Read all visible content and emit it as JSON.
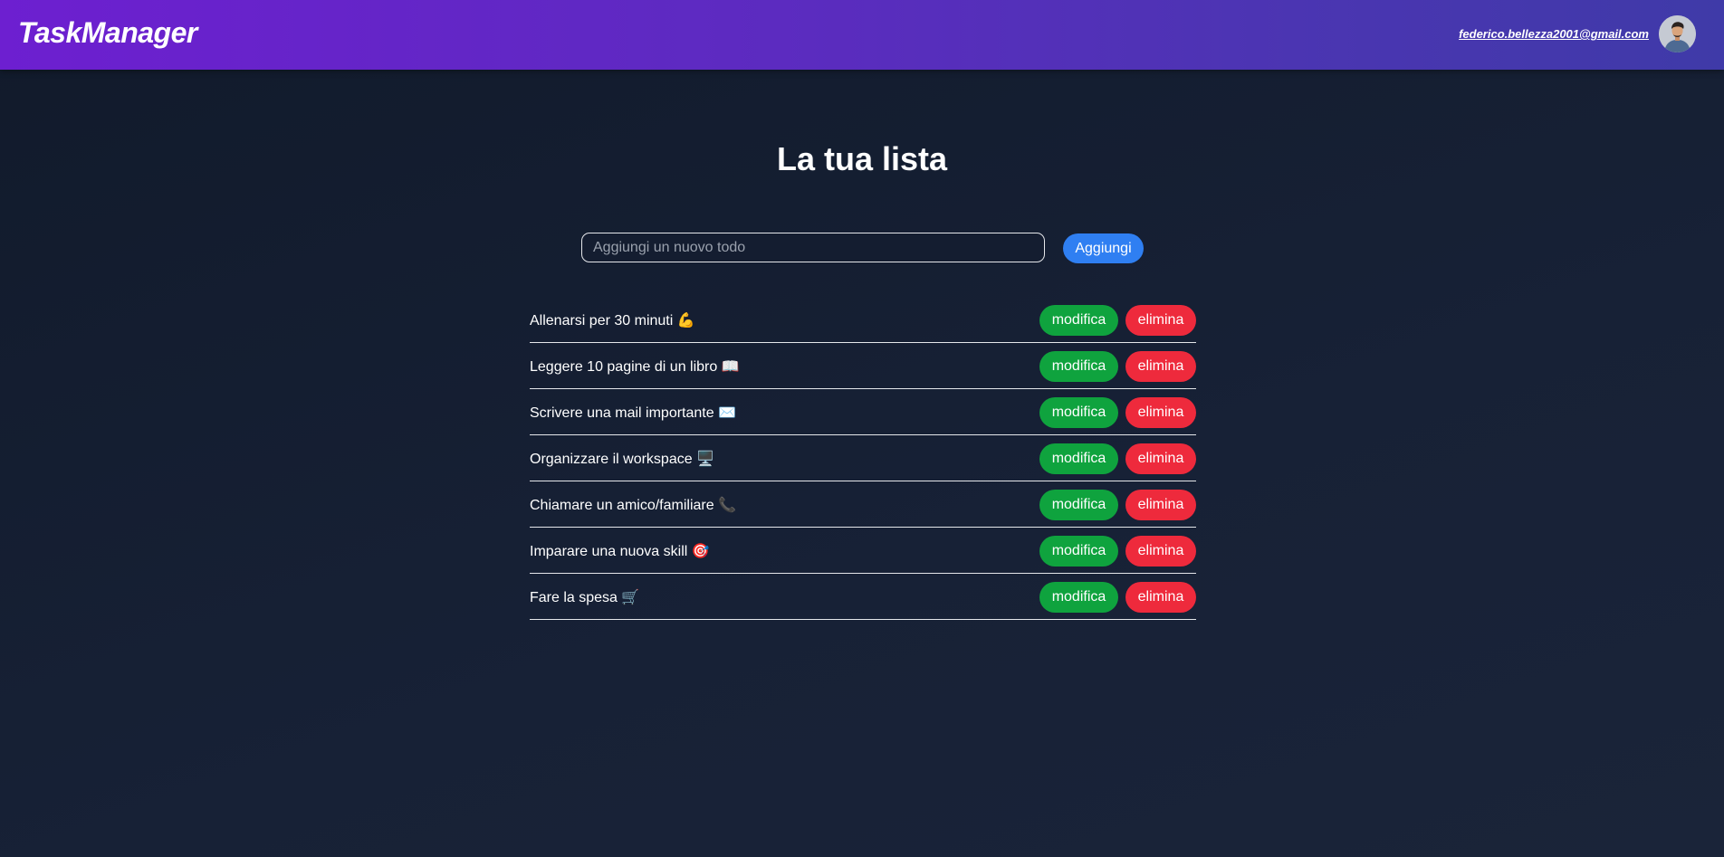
{
  "header": {
    "brand": "TaskManager",
    "user_email": "federico.bellezza2001@gmail.com",
    "avatar_icon": "user-avatar-icon"
  },
  "main": {
    "title": "La tua lista",
    "input_placeholder": "Aggiungi un nuovo todo",
    "input_value": "",
    "add_label": "Aggiungi"
  },
  "todos": [
    {
      "text": "Allenarsi per 30 minuti 💪",
      "edit_label": "modifica",
      "delete_label": "elimina"
    },
    {
      "text": "Leggere 10 pagine di un libro 📖",
      "edit_label": "modifica",
      "delete_label": "elimina"
    },
    {
      "text": "Scrivere una mail importante ✉️",
      "edit_label": "modifica",
      "delete_label": "elimina"
    },
    {
      "text": "Organizzare il workspace 🖥️",
      "edit_label": "modifica",
      "delete_label": "elimina"
    },
    {
      "text": "Chiamare un amico/familiare 📞",
      "edit_label": "modifica",
      "delete_label": "elimina"
    },
    {
      "text": "Imparare una nuova skill 🎯",
      "edit_label": "modifica",
      "delete_label": "elimina"
    },
    {
      "text": "Fare la spesa 🛒",
      "edit_label": "modifica",
      "delete_label": "elimina"
    }
  ],
  "colors": {
    "header_start": "#6d1fd0",
    "header_end": "#3f3aa8",
    "background": "#141d30",
    "add_button": "#2f7ff2",
    "edit_button": "#0fa33e",
    "delete_button": "#ee2a3c"
  }
}
